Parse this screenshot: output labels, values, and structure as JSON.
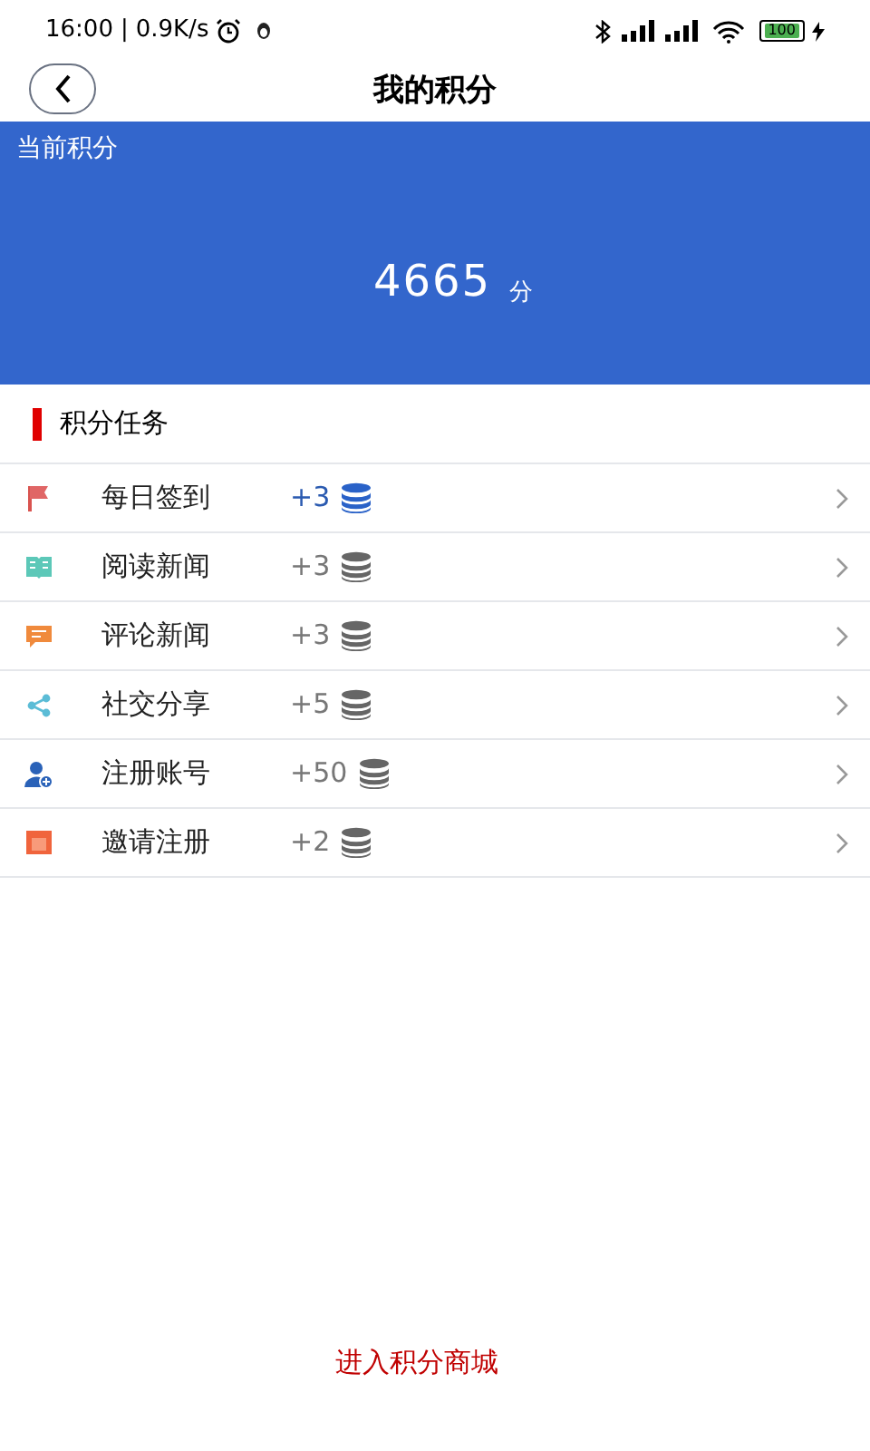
{
  "status_bar": {
    "time": "16:00",
    "separator": "|",
    "speed": "0.9K/s",
    "battery": "100"
  },
  "header": {
    "title": "我的积分"
  },
  "points": {
    "label": "当前积分",
    "value": "4665",
    "unit": "分"
  },
  "tasks_section": {
    "title": "积分任务"
  },
  "tasks": [
    {
      "kind": "flag",
      "name": "每日签到",
      "reward": "+3",
      "done": true
    },
    {
      "kind": "book",
      "name": "阅读新闻",
      "reward": "+3",
      "done": false
    },
    {
      "kind": "comment",
      "name": "评论新闻",
      "reward": "+3",
      "done": false
    },
    {
      "kind": "share",
      "name": "社交分享",
      "reward": "+5",
      "done": false
    },
    {
      "kind": "user",
      "name": "注册账号",
      "reward": "+50",
      "done": false
    },
    {
      "kind": "invite",
      "name": "邀请注册",
      "reward": "+2",
      "done": false
    }
  ],
  "mall_link": "进入积分商城"
}
